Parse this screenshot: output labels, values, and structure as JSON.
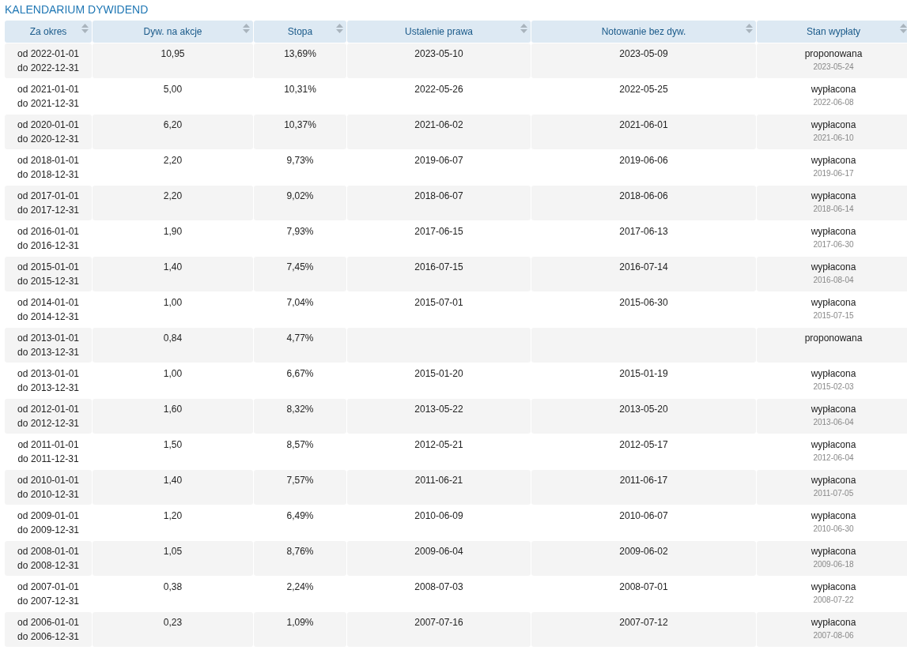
{
  "title": "KALENDARIUM DYWIDEND",
  "columns": [
    "Za okres",
    "Dyw. na akcje",
    "Stopa",
    "Ustalenie prawa",
    "Notowanie bez dyw.",
    "Stan wypłaty"
  ],
  "rows": [
    {
      "period_from": "od 2022-01-01",
      "period_to": "do 2022-12-31",
      "dividend": "10,95",
      "yield": "13,69%",
      "record_date": "2023-05-10",
      "ex_date": "2023-05-09",
      "status": "proponowana",
      "payment_date": "2023-05-24"
    },
    {
      "period_from": "od 2021-01-01",
      "period_to": "do 2021-12-31",
      "dividend": "5,00",
      "yield": "10,31%",
      "record_date": "2022-05-26",
      "ex_date": "2022-05-25",
      "status": "wypłacona",
      "payment_date": "2022-06-08"
    },
    {
      "period_from": "od 2020-01-01",
      "period_to": "do 2020-12-31",
      "dividend": "6,20",
      "yield": "10,37%",
      "record_date": "2021-06-02",
      "ex_date": "2021-06-01",
      "status": "wypłacona",
      "payment_date": "2021-06-10"
    },
    {
      "period_from": "od 2018-01-01",
      "period_to": "do 2018-12-31",
      "dividend": "2,20",
      "yield": "9,73%",
      "record_date": "2019-06-07",
      "ex_date": "2019-06-06",
      "status": "wypłacona",
      "payment_date": "2019-06-17"
    },
    {
      "period_from": "od 2017-01-01",
      "period_to": "do 2017-12-31",
      "dividend": "2,20",
      "yield": "9,02%",
      "record_date": "2018-06-07",
      "ex_date": "2018-06-06",
      "status": "wypłacona",
      "payment_date": "2018-06-14"
    },
    {
      "period_from": "od 2016-01-01",
      "period_to": "do 2016-12-31",
      "dividend": "1,90",
      "yield": "7,93%",
      "record_date": "2017-06-15",
      "ex_date": "2017-06-13",
      "status": "wypłacona",
      "payment_date": "2017-06-30"
    },
    {
      "period_from": "od 2015-01-01",
      "period_to": "do 2015-12-31",
      "dividend": "1,40",
      "yield": "7,45%",
      "record_date": "2016-07-15",
      "ex_date": "2016-07-14",
      "status": "wypłacona",
      "payment_date": "2016-08-04"
    },
    {
      "period_from": "od 2014-01-01",
      "period_to": "do 2014-12-31",
      "dividend": "1,00",
      "yield": "7,04%",
      "record_date": "2015-07-01",
      "ex_date": "2015-06-30",
      "status": "wypłacona",
      "payment_date": "2015-07-15"
    },
    {
      "period_from": "od 2013-01-01",
      "period_to": "do 2013-12-31",
      "dividend": "0,84",
      "yield": "4,77%",
      "status": "proponowana"
    },
    {
      "period_from": "od 2013-01-01",
      "period_to": "do 2013-12-31",
      "dividend": "1,00",
      "yield": "6,67%",
      "record_date": "2015-01-20",
      "ex_date": "2015-01-19",
      "status": "wypłacona",
      "payment_date": "2015-02-03"
    },
    {
      "period_from": "od 2012-01-01",
      "period_to": "do 2012-12-31",
      "dividend": "1,60",
      "yield": "8,32%",
      "record_date": "2013-05-22",
      "ex_date": "2013-05-20",
      "status": "wypłacona",
      "payment_date": "2013-06-04"
    },
    {
      "period_from": "od 2011-01-01",
      "period_to": "do 2011-12-31",
      "dividend": "1,50",
      "yield": "8,57%",
      "record_date": "2012-05-21",
      "ex_date": "2012-05-17",
      "status": "wypłacona",
      "payment_date": "2012-06-04"
    },
    {
      "period_from": "od 2010-01-01",
      "period_to": "do 2010-12-31",
      "dividend": "1,40",
      "yield": "7,57%",
      "record_date": "2011-06-21",
      "ex_date": "2011-06-17",
      "status": "wypłacona",
      "payment_date": "2011-07-05"
    },
    {
      "period_from": "od 2009-01-01",
      "period_to": "do 2009-12-31",
      "dividend": "1,20",
      "yield": "6,49%",
      "record_date": "2010-06-09",
      "ex_date": "2010-06-07",
      "status": "wypłacona",
      "payment_date": "2010-06-30"
    },
    {
      "period_from": "od 2008-01-01",
      "period_to": "do 2008-12-31",
      "dividend": "1,05",
      "yield": "8,76%",
      "record_date": "2009-06-04",
      "ex_date": "2009-06-02",
      "status": "wypłacona",
      "payment_date": "2009-06-18"
    },
    {
      "period_from": "od 2007-01-01",
      "period_to": "do 2007-12-31",
      "dividend": "0,38",
      "yield": "2,24%",
      "record_date": "2008-07-03",
      "ex_date": "2008-07-01",
      "status": "wypłacona",
      "payment_date": "2008-07-22"
    },
    {
      "period_from": "od 2006-01-01",
      "period_to": "do 2006-12-31",
      "dividend": "0,23",
      "yield": "1,09%",
      "record_date": "2007-07-16",
      "ex_date": "2007-07-12",
      "status": "wypłacona",
      "payment_date": "2007-08-06"
    }
  ]
}
